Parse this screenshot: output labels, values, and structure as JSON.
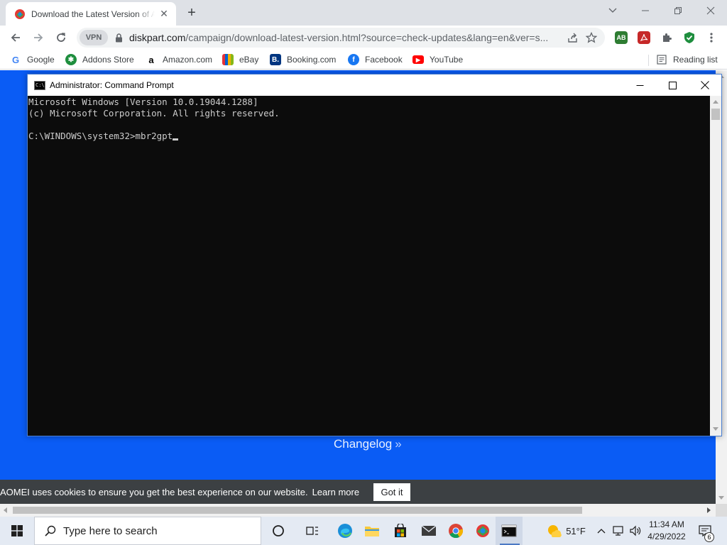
{
  "browser": {
    "tab": {
      "title": "Download the Latest Version of AOMEI"
    },
    "url": {
      "host": "diskpart.com",
      "path": "/campaign/download-latest-version.html?source=check-updates&lang=en&ver=s..."
    },
    "vpn_label": "VPN",
    "extensions": {
      "adblock": "AB"
    },
    "bookmarks": [
      {
        "label": "Google"
      },
      {
        "label": "Addons Store"
      },
      {
        "label": "Amazon.com"
      },
      {
        "label": "eBay"
      },
      {
        "label": "Booking.com"
      },
      {
        "label": "Facebook"
      },
      {
        "label": "YouTube"
      }
    ],
    "reading_list": "Reading list"
  },
  "page": {
    "changelog_label": "Changelog",
    "cookie_text": "AOMEI uses cookies to ensure you get the best experience on our website.",
    "cookie_link": "Learn more",
    "cookie_button": "Got it",
    "background_color": "#0a5cf5"
  },
  "cmd_window": {
    "title": "Administrator: Command Prompt",
    "lines": [
      "Microsoft Windows [Version 10.0.19044.1288]",
      "(c) Microsoft Corporation. All rights reserved.",
      "",
      "C:\\WINDOWS\\system32>mbr2gpt"
    ]
  },
  "taskbar": {
    "search_placeholder": "Type here to search",
    "weather": "51°F",
    "time": "11:34 AM",
    "date": "4/29/2022",
    "notification_count": "6"
  }
}
